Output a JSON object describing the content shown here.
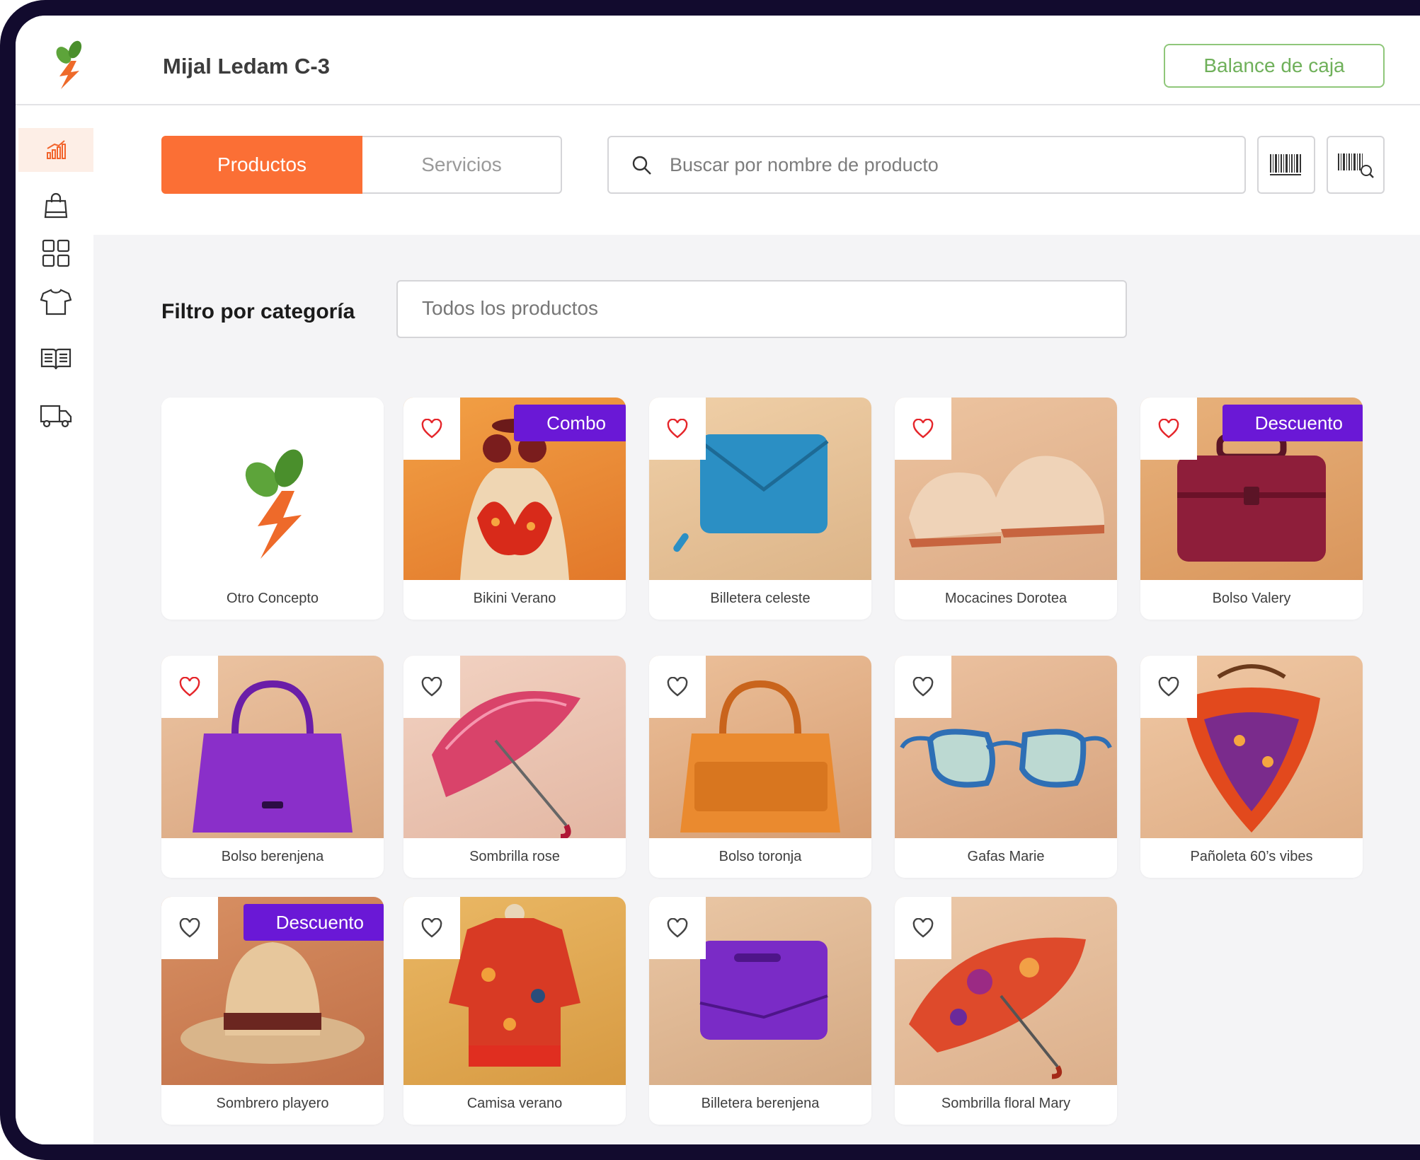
{
  "header": {
    "store_name": "Mijal Ledam C-3",
    "balance_button": "Balance de caja"
  },
  "sidebar": {
    "items": [
      {
        "name": "sales-chart",
        "active": true
      },
      {
        "name": "shopping-bag",
        "active": false
      },
      {
        "name": "grid",
        "active": false
      },
      {
        "name": "t-shirt",
        "active": false
      },
      {
        "name": "book",
        "active": false
      },
      {
        "name": "truck",
        "active": false
      }
    ]
  },
  "tabs": {
    "products": "Productos",
    "services": "Servicios"
  },
  "search": {
    "placeholder": "Buscar por nombre de producto"
  },
  "filter": {
    "label": "Filtro por categoría",
    "value": "Todos los productos"
  },
  "products": [
    {
      "name": "Otro Concepto",
      "favorite": false,
      "badge": ""
    },
    {
      "name": "Bikini Verano",
      "favorite": true,
      "badge": "Combo"
    },
    {
      "name": "Billetera celeste",
      "favorite": true,
      "badge": ""
    },
    {
      "name": "Mocacines Dorotea",
      "favorite": true,
      "badge": ""
    },
    {
      "name": "Bolso Valery",
      "favorite": true,
      "badge": "Descuento"
    },
    {
      "name": "Bolso berenjena",
      "favorite": true,
      "badge": ""
    },
    {
      "name": "Sombrilla rose",
      "favorite": false,
      "badge": ""
    },
    {
      "name": "Bolso toronja",
      "favorite": false,
      "badge": ""
    },
    {
      "name": "Gafas Marie",
      "favorite": false,
      "badge": ""
    },
    {
      "name": "Pañoleta 60’s vibes",
      "favorite": false,
      "badge": ""
    },
    {
      "name": "Sombrero playero",
      "favorite": false,
      "badge": "Descuento"
    },
    {
      "name": "Camisa verano",
      "favorite": false,
      "badge": ""
    },
    {
      "name": "Billetera berenjena",
      "favorite": false,
      "badge": ""
    },
    {
      "name": "Sombrilla floral Mary",
      "favorite": false,
      "badge": ""
    }
  ],
  "colors": {
    "accent": "#fb6f35",
    "badge": "#6a18d6",
    "heart_active": "#e5262b",
    "balance": "#6fb05a"
  }
}
